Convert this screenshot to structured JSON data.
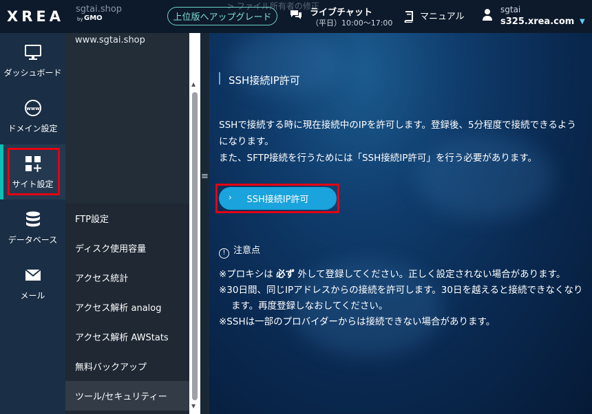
{
  "header": {
    "logo_text": "XREA",
    "logo_by": "by",
    "logo_gmo": "GMO",
    "domain": "sgtai.shop",
    "breadcrumb_ghost": "> ファイル所有者の修正",
    "upgrade_label": "上位版へアップグレード",
    "chat_title": "ライブチャット",
    "chat_hours": "（平日）10:00〜17:00",
    "manual_label": "マニュアル",
    "user_name": "sgtai",
    "user_server": "s325.xrea.com"
  },
  "nav": {
    "items": [
      {
        "label": "ダッシュボード",
        "icon": "monitor-icon"
      },
      {
        "label": "ドメイン設定",
        "icon": "www-globe-icon"
      },
      {
        "label": "サイト設定",
        "icon": "grid-plus-icon"
      },
      {
        "label": "データベース",
        "icon": "database-icon"
      },
      {
        "label": "メール",
        "icon": "envelope-icon"
      }
    ],
    "active_index": 2
  },
  "sub": {
    "domain": "www.sgtai.shop",
    "items": [
      {
        "label": "FTP設定"
      },
      {
        "label": "ディスク使用容量"
      },
      {
        "label": "アクセス統計"
      },
      {
        "label": "アクセス解析 analog"
      },
      {
        "label": "アクセス解析 AWStats"
      },
      {
        "label": "無料バックアップ"
      },
      {
        "label": "ツール/セキュリティー"
      }
    ],
    "active_index": 6
  },
  "splitter_glyph": "≡",
  "main": {
    "section_title": "SSH接続IP許可",
    "desc_line1": "SSHで接続する時に現在接続中のIPを許可します。登録後、5分程度で接続できるようになります。",
    "desc_line2": "また、SFTP接続を行うためには「SSH接続IP許可」を行う必要があります。",
    "button_label": "SSH接続IP許可",
    "notice_title": "注意点",
    "note1_pre": "※プロキシは ",
    "note1_bold": "必ず",
    "note1_post": " 外して登録してください。正しく設定されない場合があります。",
    "note2": "※30日間、同じIPアドレスからの接続を許可します。30日を越えると接続できなくなります。再度登録しなおしてください。",
    "note3": "※SSHは一部のプロバイダーからは接続できない場合があります。"
  },
  "colors": {
    "accent_teal": "#0ac0b7",
    "button_blue": "#1aa3dc",
    "highlight_red": "#e60012"
  }
}
